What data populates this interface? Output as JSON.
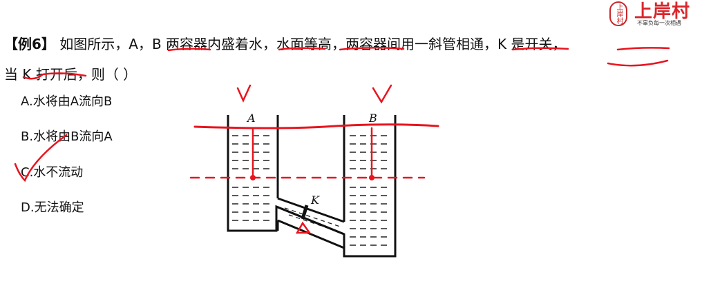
{
  "logo": {
    "seal_text": "上岸村",
    "brand": "上岸村",
    "slogan": "不辜负每一次相遇"
  },
  "question": {
    "tag": "【例6】",
    "line1": "如图所示，A，B 两容器内盛着水，水面等高，两容器间用一斜管相通，K 是开关，",
    "line2": "当 K 打开后，则（ ）"
  },
  "options": [
    {
      "label": "A.水将由A流向B"
    },
    {
      "label": "B.水将由B流向A"
    },
    {
      "label": "C.水不流动"
    },
    {
      "label": "D.无法确定"
    }
  ],
  "figure": {
    "label_a": "A",
    "label_b": "B",
    "label_k": "K"
  },
  "annotation": {
    "ink_color": "#e8141e"
  }
}
